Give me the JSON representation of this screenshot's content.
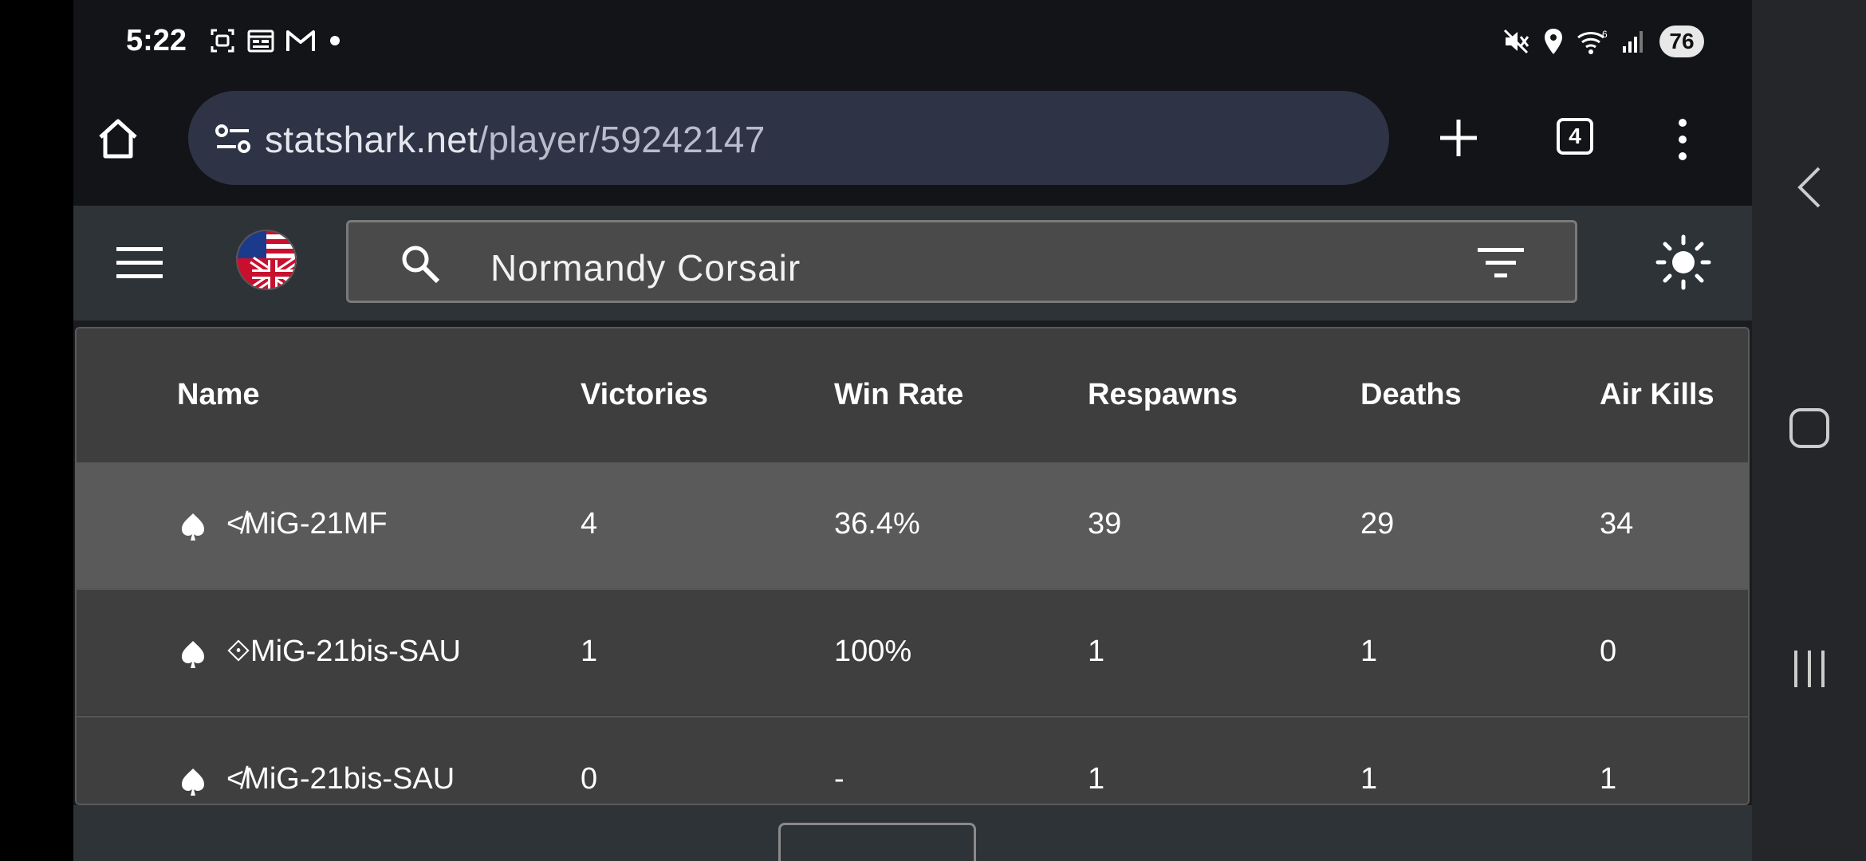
{
  "status_bar": {
    "time": "5:22",
    "left_icons": [
      "screenshot-icon",
      "calendar-icon",
      "gmail-icon",
      "dot-icon"
    ],
    "right_icons": [
      "mute-icon",
      "location-icon",
      "wifi-icon",
      "signal-icon"
    ],
    "battery": "76"
  },
  "browser": {
    "url_domain": "statshark.net",
    "url_path": "/player/59242147",
    "tab_count": "4"
  },
  "app_bar": {
    "search_value": "Normandy Corsair"
  },
  "table": {
    "headers": [
      "Name",
      "Victories",
      "Win Rate",
      "Respawns",
      "Deaths",
      "Air Kills"
    ],
    "rows": [
      {
        "marker": "≮",
        "name": "MiG-21MF",
        "victories": "4",
        "win_rate": "36.4%",
        "respawns": "39",
        "deaths": "29",
        "air_kills": "34"
      },
      {
        "marker": "⟐",
        "name": "MiG-21bis-SAU",
        "victories": "1",
        "win_rate": "100%",
        "respawns": "1",
        "deaths": "1",
        "air_kills": "0"
      },
      {
        "marker": "≮",
        "name": "MiG-21bis-SAU",
        "victories": "0",
        "win_rate": "-",
        "respawns": "1",
        "deaths": "1",
        "air_kills": "1"
      }
    ]
  },
  "colors": {
    "screen_bg": "#1b1c20",
    "url_bar": "#2e3445",
    "app_bar": "#2e3338",
    "selected_row": "#5a5a5a"
  }
}
